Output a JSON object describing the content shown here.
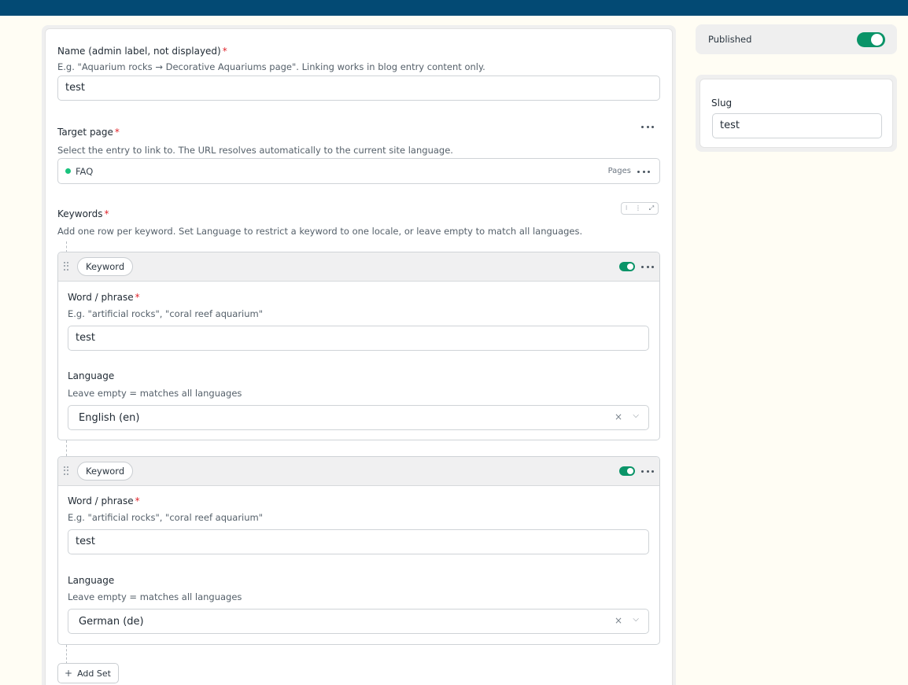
{
  "form": {
    "name": {
      "label": "Name (admin label, not displayed)",
      "required_mark": "*",
      "help": "E.g. \"Aquarium rocks → Decorative Aquariums page\". Linking works in blog entry content only.",
      "value": "test"
    },
    "target_page": {
      "label": "Target page",
      "required_mark": "*",
      "help": "Select the entry to link to. The URL resolves automatically to the current site language.",
      "entry_title": "FAQ",
      "entry_collection": "Pages",
      "entry_status_color": "#19c37d"
    },
    "keywords": {
      "label": "Keywords",
      "required_mark": "*",
      "help": "Add one row per keyword. Set Language to restrict a keyword to one locale, or leave empty to match all languages.",
      "tools": [
        "collapse-icon",
        "expand-icon",
        "fullscreen-icon"
      ],
      "sets": [
        {
          "type_label": "Keyword",
          "enabled": true,
          "word_label": "Word / phrase",
          "word_required_mark": "*",
          "word_help": "E.g. \"artificial rocks\", \"coral reef aquarium\"",
          "word_value": "test",
          "language_label": "Language",
          "language_help": "Leave empty = matches all languages",
          "language_value": "English (en)"
        },
        {
          "type_label": "Keyword",
          "enabled": true,
          "word_label": "Word / phrase",
          "word_required_mark": "*",
          "word_help": "E.g. \"artificial rocks\", \"coral reef aquarium\"",
          "word_value": "test",
          "language_label": "Language",
          "language_help": "Leave empty = matches all languages",
          "language_value": "German (de)"
        }
      ],
      "add_set_label": "Add Set"
    }
  },
  "sidebar": {
    "published": {
      "label": "Published",
      "enabled": true
    },
    "slug": {
      "label": "Slug",
      "value": "test"
    }
  },
  "colors": {
    "top_bar": "#034a74",
    "toggle_on": "#0a9468",
    "required": "#e0252c",
    "page_background": "#fffdf4"
  }
}
